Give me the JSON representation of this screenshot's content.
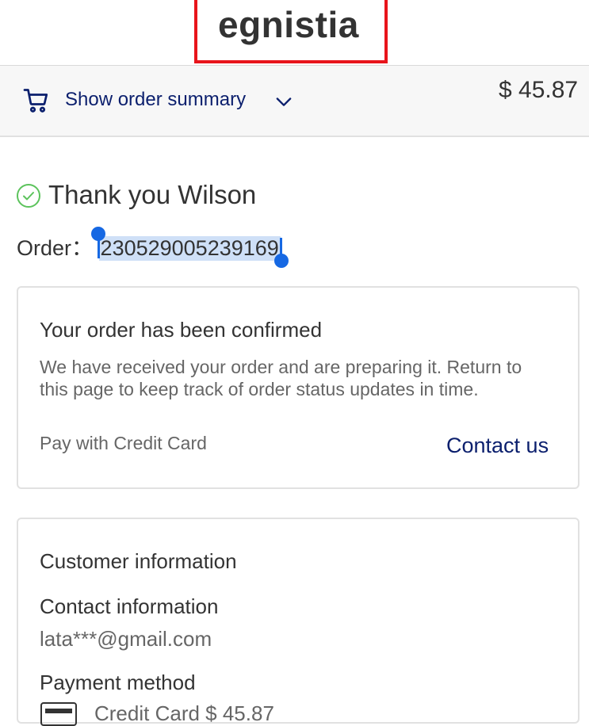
{
  "header": {
    "logo_text": "egnistia"
  },
  "summary_bar": {
    "cart_icon": "shopping-cart-icon",
    "label": "Show order summary",
    "chevron_icon": "chevron-down-icon",
    "total": "$ 45.87"
  },
  "thanks": {
    "icon": "check-circle-icon",
    "text": "Thank you Wilson"
  },
  "order": {
    "label": "Order：",
    "number": "230529005239169"
  },
  "confirm_card": {
    "title": "Your order has been confirmed",
    "description": "We have received your order and are preparing it. Return to this page to keep track of order status updates in time.",
    "payment_note": "Pay with Credit Card",
    "contact_link": "Contact us"
  },
  "customer_card": {
    "title": "Customer information",
    "contact_heading": "Contact information",
    "email": "lata***@gmail.com",
    "payment_heading": "Payment method",
    "payment_value": "Credit Card $ 45.87"
  },
  "colors": {
    "brand_navy": "#0b1f6d",
    "logo_border": "#e8141b",
    "check_green": "#5cc35c",
    "selection_blue": "#1668e3",
    "selection_bg": "#cfe0f7"
  }
}
